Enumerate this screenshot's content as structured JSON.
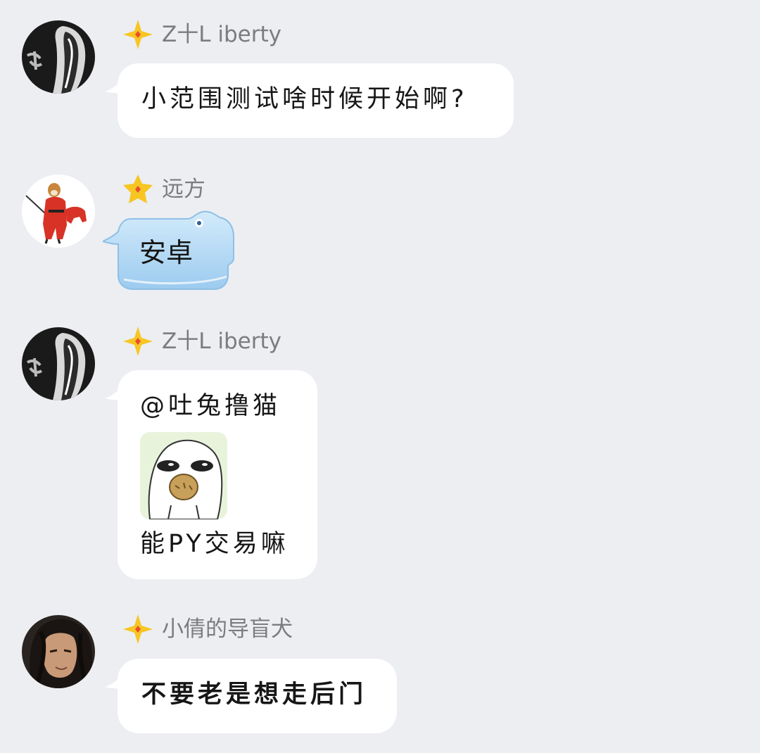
{
  "messages": [
    {
      "sender": "Z十L iberty",
      "text": "小范围测试啥时候开始啊?",
      "avatar": "avatar-dark-figure"
    },
    {
      "sender": "远方",
      "text": "安卓",
      "avatar": "avatar-shiba-warrior",
      "bubble_color": "#bfe0f7"
    },
    {
      "sender": "Z十L iberty",
      "mention": "@吐兔撸猫",
      "sticker": "staring-face-sticker",
      "text": "能PY交易嘛",
      "avatar": "avatar-dark-figure"
    },
    {
      "sender": "小倩的导盲犬",
      "text": "不要老是想走后门",
      "avatar": "avatar-long-hair-man"
    }
  ],
  "colors": {
    "background": "#eceef2",
    "bubble": "#ffffff",
    "sender_name": "#7c7c80",
    "star": "#f7c623"
  }
}
